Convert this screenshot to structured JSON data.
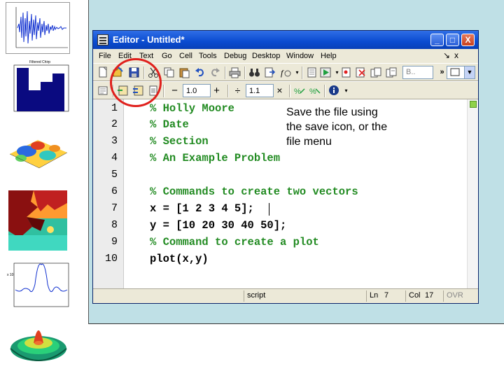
{
  "window": {
    "title": "Editor - Untitled*",
    "min_label": "_",
    "max_label": "□",
    "close_label": "X"
  },
  "menu": {
    "items": [
      "File",
      "Edit",
      "Text",
      "Go",
      "Cell",
      "Tools",
      "Debug",
      "Desktop",
      "Window",
      "Help"
    ],
    "arrow": "↘",
    "close": "x"
  },
  "toolbar1": {
    "stack_combo": "B..",
    "more": "»"
  },
  "toolbar2": {
    "minus": "−",
    "field1_value": "1.0",
    "plus": "+",
    "divide": "÷",
    "field2_value": "1.1",
    "times": "×"
  },
  "code": {
    "line_numbers": [
      "1",
      "2",
      "3",
      "4",
      "5",
      "6",
      "7",
      "8",
      "9",
      "10"
    ],
    "lines": [
      {
        "text": "% Holly Moore",
        "kind": "comment"
      },
      {
        "text": "% Date",
        "kind": "comment"
      },
      {
        "text": "% Section",
        "kind": "comment"
      },
      {
        "text": "% An Example Problem",
        "kind": "comment"
      },
      {
        "text": "",
        "kind": "code"
      },
      {
        "text": "% Commands to create two vectors",
        "kind": "comment"
      },
      {
        "text": "x = [1 2 3 4 5];",
        "kind": "code"
      },
      {
        "text": "y = [10 20 30 40 50];",
        "kind": "code"
      },
      {
        "text": "% Command to create a plot",
        "kind": "comment"
      },
      {
        "text": "plot(x,y)",
        "kind": "code"
      }
    ]
  },
  "annotation": {
    "text_line1": "Save the file using",
    "text_line2": "the save icon, or the",
    "text_line3": "file menu"
  },
  "status": {
    "mode": "script",
    "ln_label": "Ln",
    "ln_value": "7",
    "col_label": "Col",
    "col_value": "17",
    "ovr": "OVR"
  },
  "colors": {
    "comment": "#228b22",
    "title_bar": "#0a4bd0",
    "highlight_circle": "#e0201c",
    "slide_bg": "#bfe0e6"
  },
  "thumbnails": {
    "plot1_title": "Filtered Chirp",
    "plot2_title": "",
    "plot_note": "x 10"
  }
}
